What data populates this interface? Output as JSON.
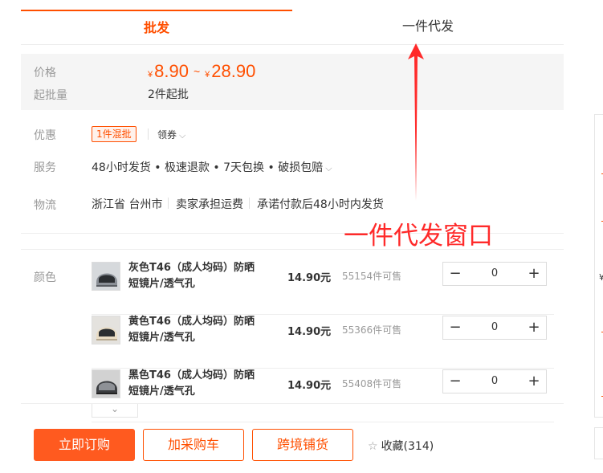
{
  "tabs": [
    {
      "label": "批发",
      "active": true
    },
    {
      "label": "一件代发",
      "active": false
    }
  ],
  "price": {
    "label": "价格",
    "currency": "¥",
    "low": "8.90",
    "separator": "~",
    "high": "28.90",
    "min_label": "起批量",
    "min_value": "2件起批"
  },
  "offers": {
    "label": "优惠",
    "tag": "1件混批",
    "coupon": "领券"
  },
  "service": {
    "label": "服务",
    "text": "48小时发货 • 极速退款 • 7天包换 • 破损包赔"
  },
  "logistics": {
    "label": "物流",
    "origin": "浙江省 台州市",
    "shipping": "卖家承担运费",
    "promise": "承诺付款后48小时内发货"
  },
  "color_label": "颜色",
  "skus": [
    {
      "name": "灰色T46（成人均码）防晒短镜片/透气孔",
      "price": "14.90元",
      "stock": "55154件可售",
      "qty": "0",
      "thumb_color": "#8a8f96"
    },
    {
      "name": "黄色T46（成人均码）防晒短镜片/透气孔",
      "price": "14.90元",
      "stock": "55366件可售",
      "qty": "0",
      "thumb_color": "#e9dcc4"
    },
    {
      "name": "黑色T46（成人均码）防晒短镜片/透气孔",
      "price": "14.90元",
      "stock": "55408件可售",
      "qty": "0",
      "thumb_color": "#3b3d40"
    }
  ],
  "stepper": {
    "minus": "−",
    "plus": "+"
  },
  "expand_icon": "⌄",
  "actions": {
    "order": "立即订购",
    "cart": "加采购车",
    "cross_border": "跨境铺货",
    "favorite_label": "收藏(314)",
    "favorite_icon": "☆"
  },
  "annotation": {
    "text": "一件代发窗口",
    "color": "#ff2a2a"
  },
  "colors": {
    "accent": "#ff4f00",
    "primary_button": "#ff5a1f"
  },
  "side": {
    "text": "¥"
  }
}
